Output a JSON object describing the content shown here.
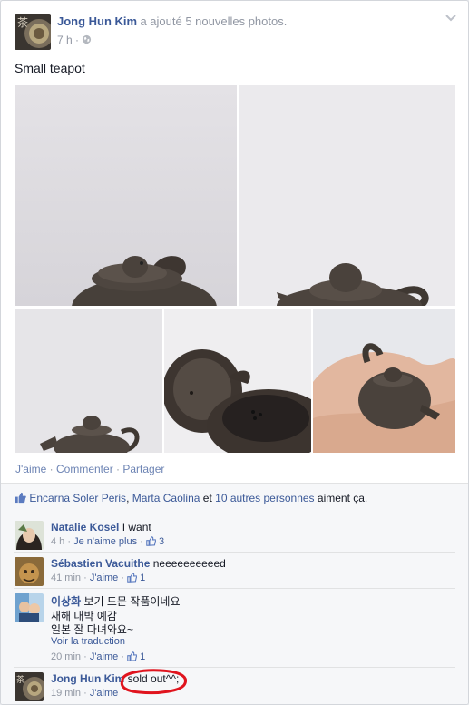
{
  "post": {
    "author": "Jong Hun Kim",
    "action_text": "a ajouté 5 nouvelles photos.",
    "time": "7 h",
    "audience_icon": "globe-icon",
    "caption": "Small teapot"
  },
  "actions": {
    "like": "J'aime",
    "comment": "Commenter",
    "share": "Partager",
    "separator": "·"
  },
  "likes": {
    "name1": "Encarna Soler Peris",
    "name2": "Marta Caolina",
    "and": "et",
    "others": "10 autres personnes",
    "suffix": "aiment ça."
  },
  "comments": [
    {
      "author": "Natalie Kosel",
      "text": "I want",
      "time": "4 h",
      "like_label": "Je n'aime plus",
      "like_count": "3"
    },
    {
      "author": "Sébastien Vacuithe",
      "text": "neeeeeeeeeed",
      "time": "41 min",
      "like_label": "J'aime",
      "like_count": "1"
    },
    {
      "author": "이상화",
      "text_line1": "보기 드문 작품이네요",
      "text_line2": "새해 대박 예감",
      "text_line3": "일본 잘 다녀와요~",
      "translate": "Voir la traduction",
      "time": "20 min",
      "like_label": "J'aime",
      "like_count": "1"
    },
    {
      "author": "Jong Hun Kim",
      "text": "sold out^^;",
      "time": "19 min",
      "like_label": "J'aime"
    }
  ],
  "colors": {
    "link": "#3b5998",
    "muted": "#9197a3",
    "highlight_circle": "#e0141e"
  }
}
